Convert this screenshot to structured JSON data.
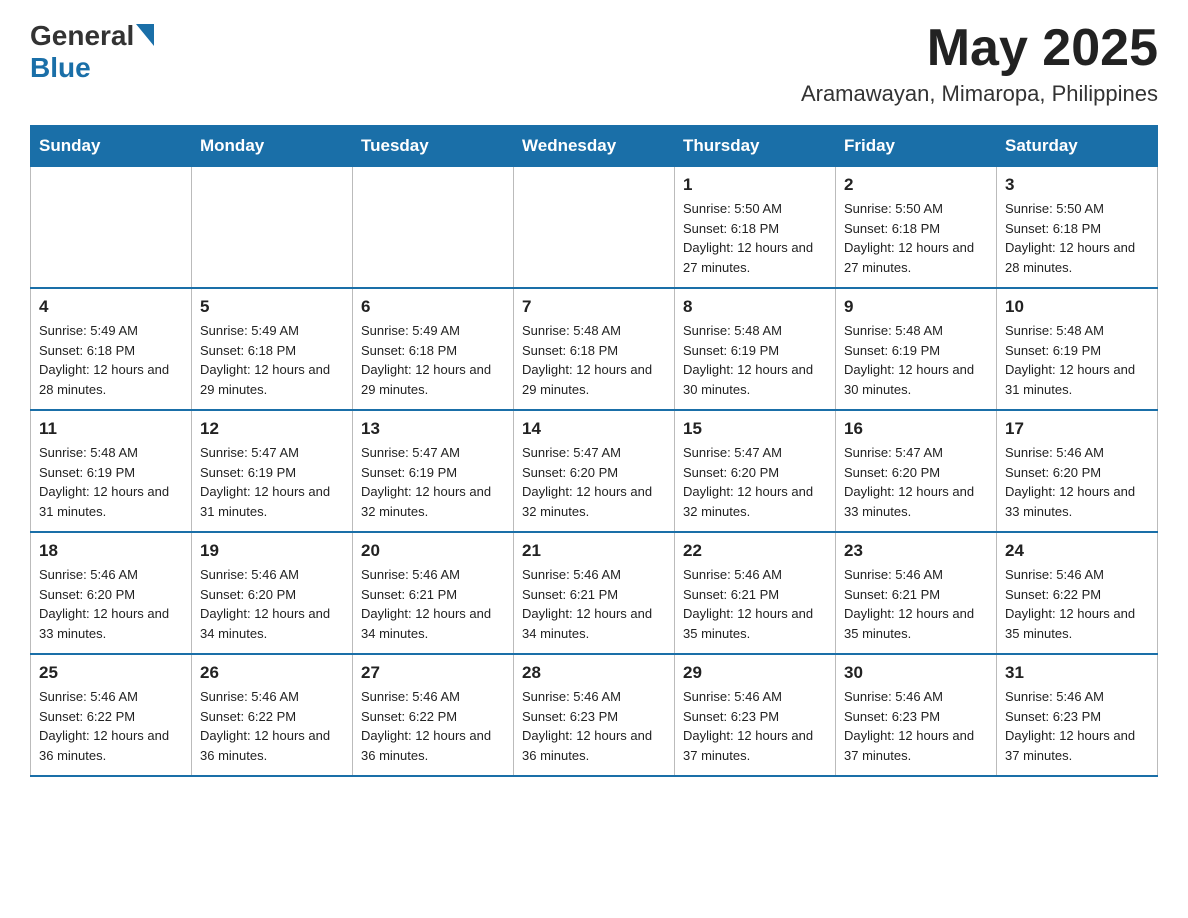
{
  "logo": {
    "general": "General",
    "blue": "Blue"
  },
  "header": {
    "month_year": "May 2025",
    "location": "Aramawayan, Mimaropa, Philippines"
  },
  "days_of_week": [
    "Sunday",
    "Monday",
    "Tuesday",
    "Wednesday",
    "Thursday",
    "Friday",
    "Saturday"
  ],
  "weeks": [
    {
      "days": [
        {
          "num": "",
          "info": ""
        },
        {
          "num": "",
          "info": ""
        },
        {
          "num": "",
          "info": ""
        },
        {
          "num": "",
          "info": ""
        },
        {
          "num": "1",
          "info": "Sunrise: 5:50 AM\nSunset: 6:18 PM\nDaylight: 12 hours and 27 minutes."
        },
        {
          "num": "2",
          "info": "Sunrise: 5:50 AM\nSunset: 6:18 PM\nDaylight: 12 hours and 27 minutes."
        },
        {
          "num": "3",
          "info": "Sunrise: 5:50 AM\nSunset: 6:18 PM\nDaylight: 12 hours and 28 minutes."
        }
      ]
    },
    {
      "days": [
        {
          "num": "4",
          "info": "Sunrise: 5:49 AM\nSunset: 6:18 PM\nDaylight: 12 hours and 28 minutes."
        },
        {
          "num": "5",
          "info": "Sunrise: 5:49 AM\nSunset: 6:18 PM\nDaylight: 12 hours and 29 minutes."
        },
        {
          "num": "6",
          "info": "Sunrise: 5:49 AM\nSunset: 6:18 PM\nDaylight: 12 hours and 29 minutes."
        },
        {
          "num": "7",
          "info": "Sunrise: 5:48 AM\nSunset: 6:18 PM\nDaylight: 12 hours and 29 minutes."
        },
        {
          "num": "8",
          "info": "Sunrise: 5:48 AM\nSunset: 6:19 PM\nDaylight: 12 hours and 30 minutes."
        },
        {
          "num": "9",
          "info": "Sunrise: 5:48 AM\nSunset: 6:19 PM\nDaylight: 12 hours and 30 minutes."
        },
        {
          "num": "10",
          "info": "Sunrise: 5:48 AM\nSunset: 6:19 PM\nDaylight: 12 hours and 31 minutes."
        }
      ]
    },
    {
      "days": [
        {
          "num": "11",
          "info": "Sunrise: 5:48 AM\nSunset: 6:19 PM\nDaylight: 12 hours and 31 minutes."
        },
        {
          "num": "12",
          "info": "Sunrise: 5:47 AM\nSunset: 6:19 PM\nDaylight: 12 hours and 31 minutes."
        },
        {
          "num": "13",
          "info": "Sunrise: 5:47 AM\nSunset: 6:19 PM\nDaylight: 12 hours and 32 minutes."
        },
        {
          "num": "14",
          "info": "Sunrise: 5:47 AM\nSunset: 6:20 PM\nDaylight: 12 hours and 32 minutes."
        },
        {
          "num": "15",
          "info": "Sunrise: 5:47 AM\nSunset: 6:20 PM\nDaylight: 12 hours and 32 minutes."
        },
        {
          "num": "16",
          "info": "Sunrise: 5:47 AM\nSunset: 6:20 PM\nDaylight: 12 hours and 33 minutes."
        },
        {
          "num": "17",
          "info": "Sunrise: 5:46 AM\nSunset: 6:20 PM\nDaylight: 12 hours and 33 minutes."
        }
      ]
    },
    {
      "days": [
        {
          "num": "18",
          "info": "Sunrise: 5:46 AM\nSunset: 6:20 PM\nDaylight: 12 hours and 33 minutes."
        },
        {
          "num": "19",
          "info": "Sunrise: 5:46 AM\nSunset: 6:20 PM\nDaylight: 12 hours and 34 minutes."
        },
        {
          "num": "20",
          "info": "Sunrise: 5:46 AM\nSunset: 6:21 PM\nDaylight: 12 hours and 34 minutes."
        },
        {
          "num": "21",
          "info": "Sunrise: 5:46 AM\nSunset: 6:21 PM\nDaylight: 12 hours and 34 minutes."
        },
        {
          "num": "22",
          "info": "Sunrise: 5:46 AM\nSunset: 6:21 PM\nDaylight: 12 hours and 35 minutes."
        },
        {
          "num": "23",
          "info": "Sunrise: 5:46 AM\nSunset: 6:21 PM\nDaylight: 12 hours and 35 minutes."
        },
        {
          "num": "24",
          "info": "Sunrise: 5:46 AM\nSunset: 6:22 PM\nDaylight: 12 hours and 35 minutes."
        }
      ]
    },
    {
      "days": [
        {
          "num": "25",
          "info": "Sunrise: 5:46 AM\nSunset: 6:22 PM\nDaylight: 12 hours and 36 minutes."
        },
        {
          "num": "26",
          "info": "Sunrise: 5:46 AM\nSunset: 6:22 PM\nDaylight: 12 hours and 36 minutes."
        },
        {
          "num": "27",
          "info": "Sunrise: 5:46 AM\nSunset: 6:22 PM\nDaylight: 12 hours and 36 minutes."
        },
        {
          "num": "28",
          "info": "Sunrise: 5:46 AM\nSunset: 6:23 PM\nDaylight: 12 hours and 36 minutes."
        },
        {
          "num": "29",
          "info": "Sunrise: 5:46 AM\nSunset: 6:23 PM\nDaylight: 12 hours and 37 minutes."
        },
        {
          "num": "30",
          "info": "Sunrise: 5:46 AM\nSunset: 6:23 PM\nDaylight: 12 hours and 37 minutes."
        },
        {
          "num": "31",
          "info": "Sunrise: 5:46 AM\nSunset: 6:23 PM\nDaylight: 12 hours and 37 minutes."
        }
      ]
    }
  ]
}
